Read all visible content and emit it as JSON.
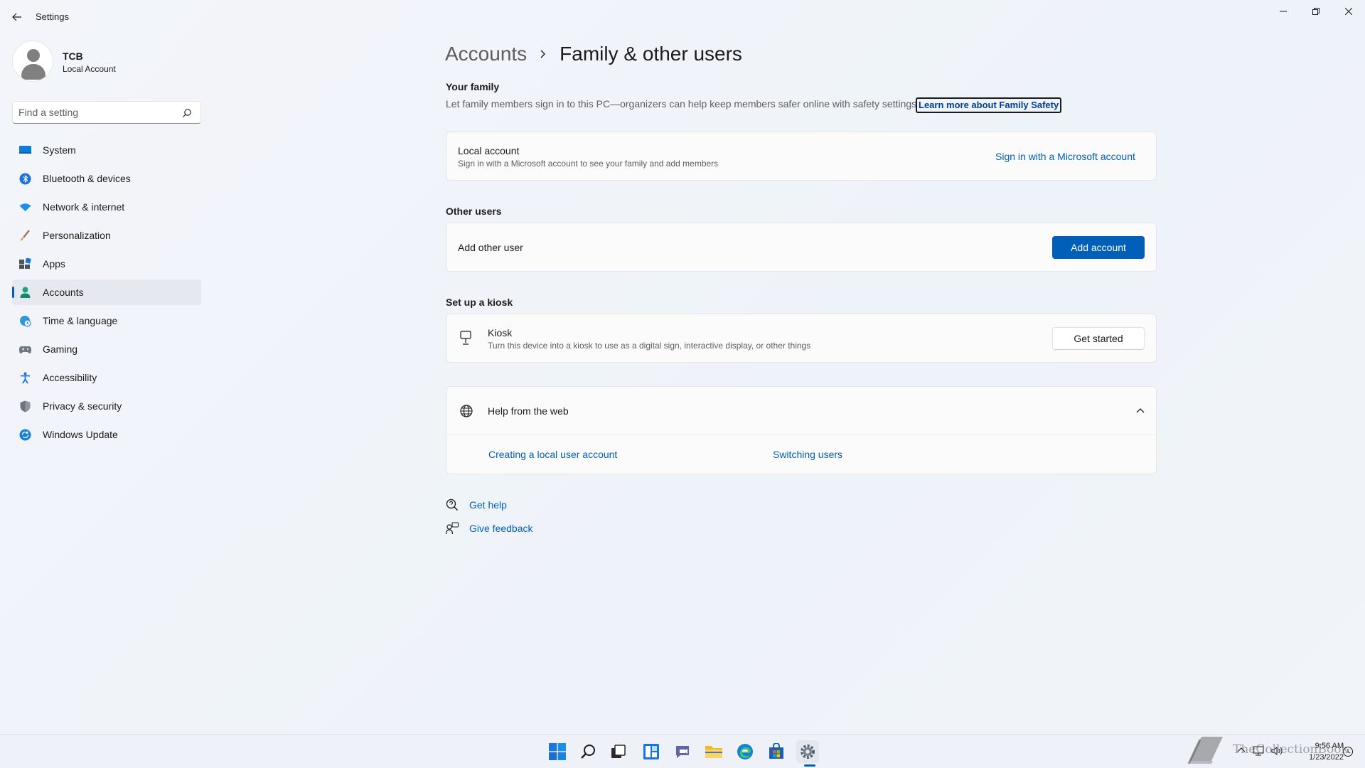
{
  "window": {
    "app_title": "Settings"
  },
  "profile": {
    "name": "TCB",
    "account_type": "Local Account"
  },
  "search": {
    "placeholder": "Find a setting"
  },
  "sidebar": {
    "items": [
      {
        "label": "System",
        "icon": "system-icon"
      },
      {
        "label": "Bluetooth & devices",
        "icon": "bluetooth-icon"
      },
      {
        "label": "Network & internet",
        "icon": "wifi-icon"
      },
      {
        "label": "Personalization",
        "icon": "brush-icon"
      },
      {
        "label": "Apps",
        "icon": "apps-icon"
      },
      {
        "label": "Accounts",
        "icon": "person-icon",
        "active": true
      },
      {
        "label": "Time & language",
        "icon": "globe-clock-icon"
      },
      {
        "label": "Gaming",
        "icon": "gamepad-icon"
      },
      {
        "label": "Accessibility",
        "icon": "accessibility-icon"
      },
      {
        "label": "Privacy & security",
        "icon": "shield-icon"
      },
      {
        "label": "Windows Update",
        "icon": "update-icon"
      }
    ]
  },
  "breadcrumb": {
    "parent": "Accounts",
    "current": "Family & other users"
  },
  "family": {
    "title": "Your family",
    "description": "Let family members sign in to this PC—organizers can help keep members safer online with safety settings",
    "learn_more": "Learn more about Family Safety",
    "card_title": "Local account",
    "card_sub": "Sign in with a Microsoft account to see your family and add members",
    "card_action": "Sign in with a Microsoft account"
  },
  "other_users": {
    "title": "Other users",
    "card_title": "Add other user",
    "button": "Add account"
  },
  "kiosk": {
    "title": "Set up a kiosk",
    "card_title": "Kiosk",
    "card_sub": "Turn this device into a kiosk to use as a digital sign, interactive display, or other things",
    "button": "Get started"
  },
  "help": {
    "title": "Help from the web",
    "links": [
      "Creating a local user account",
      "Switching users"
    ]
  },
  "footer": {
    "get_help": "Get help",
    "give_feedback": "Give feedback"
  },
  "taskbar": {
    "time": "9:56 AM",
    "date": "1/23/2022",
    "watermark": "TheCollectionBook"
  },
  "colors": {
    "accent": "#005fb8"
  }
}
